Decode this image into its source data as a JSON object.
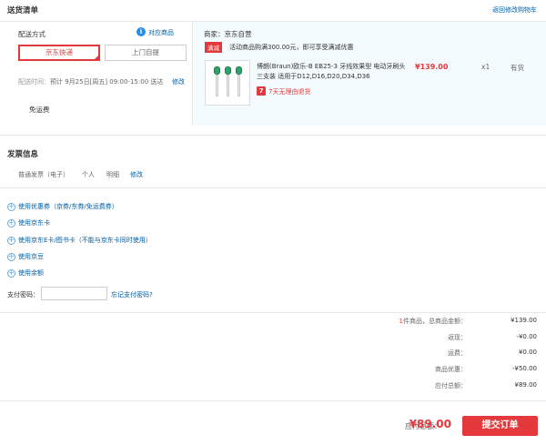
{
  "header": {
    "title": "送货清单",
    "back_to_cart": "返回修改购物车"
  },
  "shipping": {
    "method_label": "配送方式",
    "match_goods": "对应商品",
    "options": [
      {
        "label": "京东快递",
        "selected": true
      },
      {
        "label": "上门自提",
        "selected": false
      }
    ],
    "time_label": "配送时间：",
    "time_value": "预计 9月25日[周五] 09:00-15:00 送达",
    "edit": "修改",
    "free_shipping": "免运费"
  },
  "store": {
    "seller": "商家：京东自营",
    "promo_badge": "满减",
    "promo_text": "活动商品购满300.00元，即可享受满减优惠",
    "product": {
      "name": "博朗(Braun)欧乐-B EB25-3 牙线效果型 电动牙刷头三支装 适用于D12,D16,D20,D34,D36",
      "return_badge": "7",
      "return_text": "7天无理由退货",
      "price": "¥139.00",
      "qty": "x1",
      "stock": "有货"
    }
  },
  "invoice": {
    "title": "发票信息",
    "type": "普通发票（电子）",
    "who": "个人",
    "detail": "明细",
    "edit": "修改"
  },
  "payment_options": [
    "使用优惠券（京券/东券/免运费券）",
    "使用京东卡",
    "使用京东E卡/图书卡（不能与京东卡同时使用）",
    "使用京豆",
    "使用余额"
  ],
  "password": {
    "label": "支付密码：",
    "value": "",
    "forgot": "忘记支付密码?"
  },
  "summary": {
    "count_num": "1",
    "count_label": "件商品，总商品金额：",
    "rows": [
      {
        "label": "1件商品，总商品金额：",
        "value": "¥139.00"
      },
      {
        "label": "返现：",
        "value": "-¥0.00"
      },
      {
        "label": "运费：",
        "value": "¥0.00"
      },
      {
        "label": "商品优惠：",
        "value": "-¥50.00"
      },
      {
        "label": "应付总额：",
        "value": "¥89.00"
      }
    ],
    "values": [
      "¥139.00",
      "-¥0.00",
      "¥0.00",
      "-¥50.00",
      "¥89.00"
    ],
    "labels": [
      "返现：",
      "运费：",
      "商品优惠：",
      "应付总额："
    ]
  },
  "footer": {
    "pay_label": "应付总额：",
    "pay_total": "¥89.00",
    "submit": "提交订单"
  },
  "colors": {
    "accent": "#e4393c",
    "link": "#005ea7",
    "store_bg": "#f3fbfe"
  }
}
